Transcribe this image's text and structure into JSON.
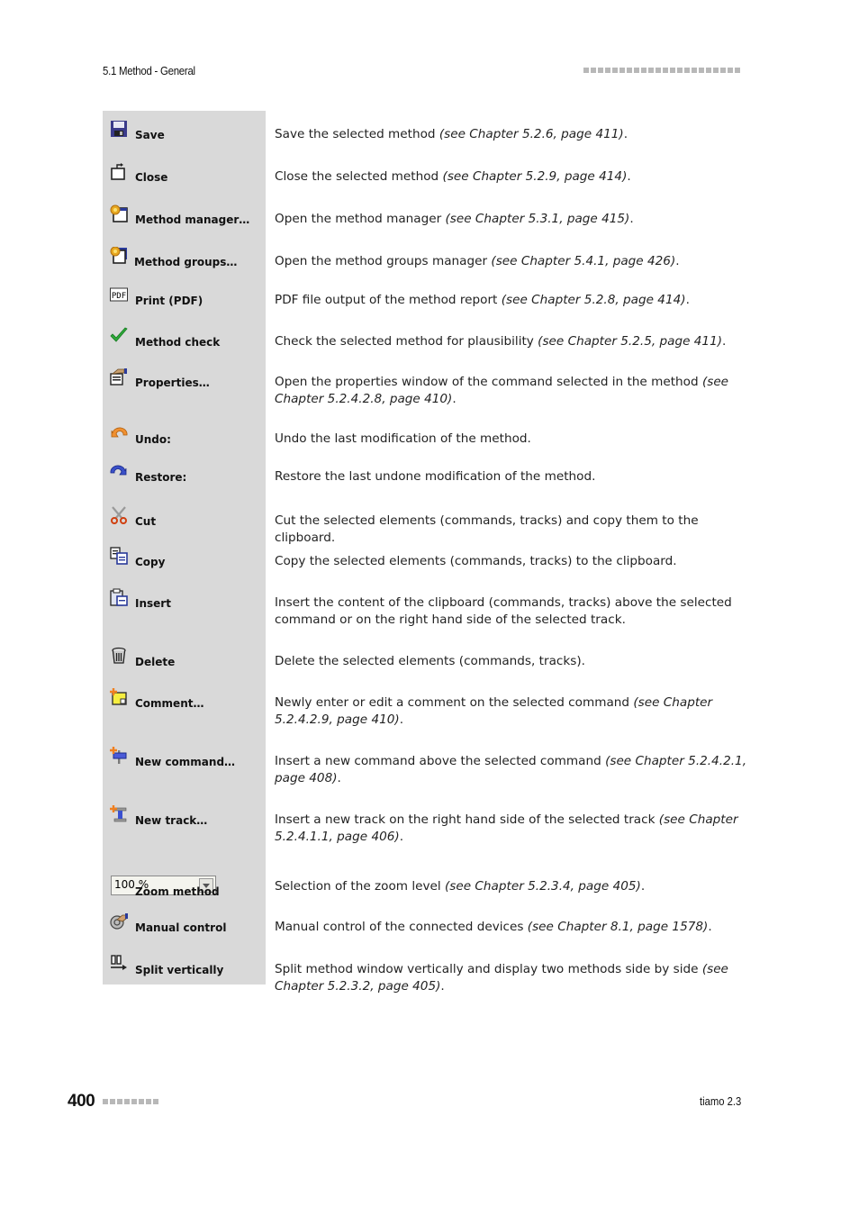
{
  "header": {
    "section": "5.1 Method - General",
    "dot_count": 22
  },
  "footer": {
    "page_number": "400",
    "dot_count": 8,
    "product": "tiamo 2.3"
  },
  "rows": [
    {
      "icon": "save-icon",
      "label": "Save",
      "desc": "Save the selected method ",
      "ref": "(see Chapter 5.2.6, page 411)",
      "tail": "."
    },
    {
      "icon": "close-icon",
      "label": "Close",
      "desc": "Close the selected method ",
      "ref": "(see Chapter 5.2.9, page 414)",
      "tail": "."
    },
    {
      "icon": "method-manager-icon",
      "label": "Method manager…",
      "desc": "Open the method manager ",
      "ref": "(see Chapter 5.3.1, page 415)",
      "tail": "."
    },
    {
      "icon": "method-groups-icon",
      "label": "Method groups…",
      "desc": "Open the method groups manager ",
      "ref": "(see Chapter 5.4.1, page 426)",
      "tail": "."
    },
    {
      "icon": "pdf-icon",
      "label": "Print (PDF)",
      "desc": "PDF file output of the method report ",
      "ref": "(see Chapter 5.2.8, page 414)",
      "tail": "."
    },
    {
      "icon": "checkmark-icon",
      "label": "Method check",
      "desc": "Check the selected method for plausibility ",
      "ref": "(see Chapter 5.2.5, page 411)",
      "tail": "."
    },
    {
      "icon": "properties-icon",
      "label": "Properties…",
      "desc": "Open the properties window of the command selected in the method ",
      "ref": "(see Chapter 5.2.4.2.8, page 410)",
      "tail": "."
    },
    {
      "icon": "undo-icon",
      "label": "Undo:",
      "desc": "Undo the last modification of the method.",
      "ref": "",
      "tail": ""
    },
    {
      "icon": "redo-icon",
      "label": "Restore:",
      "desc": "Restore the last undone modification of the method.",
      "ref": "",
      "tail": ""
    },
    {
      "icon": "scissors-icon",
      "label": "Cut",
      "desc": "Cut the selected elements (commands, tracks) and copy them to the clipboard.",
      "ref": "",
      "tail": ""
    },
    {
      "icon": "copy-icon",
      "label": "Copy",
      "desc": "Copy the selected elements (commands, tracks) to the clipboard.",
      "ref": "",
      "tail": ""
    },
    {
      "icon": "paste-icon",
      "label": "Insert",
      "desc": "Insert the content of the clipboard (commands, tracks) above the selected com­mand or on the right hand side of the selected track.",
      "ref": "",
      "tail": ""
    },
    {
      "icon": "trash-icon",
      "label": "Delete",
      "desc": "Delete the selected elements (commands, tracks).",
      "ref": "",
      "tail": ""
    },
    {
      "icon": "comment-icon",
      "label": "Comment…",
      "desc": "Newly enter or edit a comment on the selected command ",
      "ref": "(see Chapter 5.2.4.2.9, page 410)",
      "tail": "."
    },
    {
      "icon": "new-command-icon",
      "label": "New command…",
      "desc": "Insert a new command above the selected command ",
      "ref": "(see Chapter 5.2.4.2.1, page 408)",
      "tail": "."
    },
    {
      "icon": "new-track-icon",
      "label": "New track…",
      "desc": "Insert a new track on the right hand side of the selected track ",
      "ref": "(see Chapter 5.2.4.1.1, page 406)",
      "tail": "."
    },
    {
      "icon": "zoom-combo",
      "label": "Zoom method",
      "combo_value": "100 %",
      "desc": "Selection of the zoom level ",
      "ref": "(see Chapter 5.2.3.4, page 405)",
      "tail": "."
    },
    {
      "icon": "manual-control-icon",
      "label": "Manual control",
      "desc": "Manual control of the connected devices ",
      "ref": "(see Chapter 8.1, page 1578)",
      "tail": "."
    },
    {
      "icon": "split-vertical-icon",
      "label": "Split vertically",
      "desc": "Split method window vertically and display two methods side by side ",
      "ref": "(see Chap­ter 5.2.3.2, page 405)",
      "tail": "."
    }
  ]
}
